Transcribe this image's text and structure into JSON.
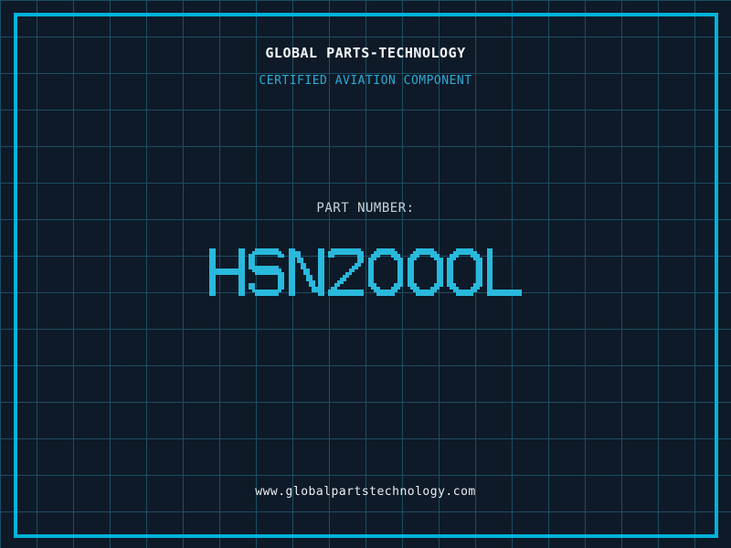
{
  "page": {
    "colors": {
      "bg": "#0f1a28",
      "grid": "#1b4e64",
      "frame": "#00b2da",
      "accent": "#29b9dc",
      "subtitle": "#2baad4",
      "title": "#f5f8fa",
      "label": "#c9d3dc",
      "url": "#e9eef2"
    }
  },
  "header": {
    "title": "GLOBAL PARTS-TECHNOLOGY",
    "subtitle": "CERTIFIED AVIATION COMPONENT"
  },
  "part": {
    "label": "PART NUMBER:",
    "number": "HSN2000L"
  },
  "footer": {
    "url": "www.globalpartstechnology.com"
  }
}
